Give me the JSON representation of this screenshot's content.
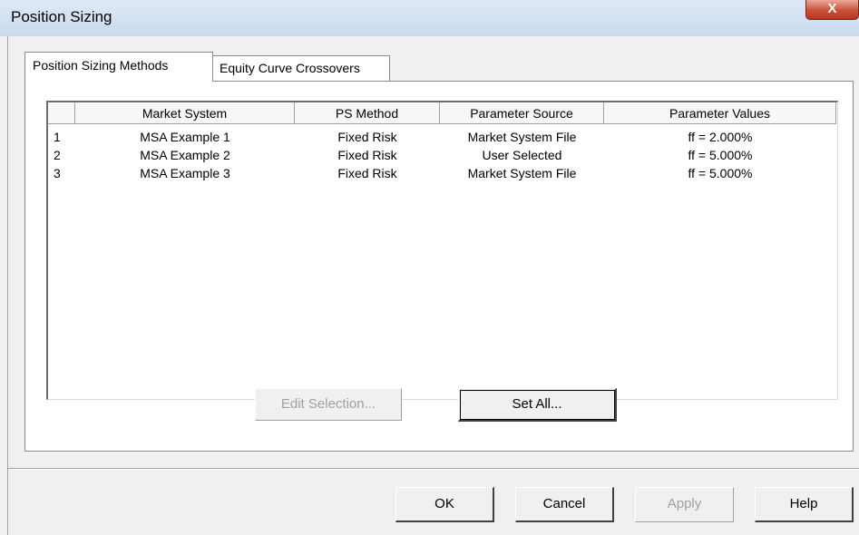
{
  "window": {
    "title": "Position Sizing",
    "close_glyph": "X"
  },
  "tabs": [
    {
      "label": "Position Sizing Methods",
      "active": true
    },
    {
      "label": "Equity Curve Crossovers",
      "active": false
    }
  ],
  "table": {
    "columns": [
      "",
      "Market System",
      "PS Method",
      "Parameter Source",
      "Parameter Values"
    ],
    "rows": [
      {
        "num": "1",
        "market_system": "MSA Example 1",
        "ps_method": "Fixed Risk",
        "parameter_source": "Market System File",
        "parameter_values": "ff = 2.000%"
      },
      {
        "num": "2",
        "market_system": "MSA Example 2",
        "ps_method": "Fixed Risk",
        "parameter_source": "User Selected",
        "parameter_values": "ff = 5.000%"
      },
      {
        "num": "3",
        "market_system": "MSA Example 3",
        "ps_method": "Fixed Risk",
        "parameter_source": "Market System File",
        "parameter_values": "ff = 5.000%"
      }
    ]
  },
  "panel_buttons": {
    "edit_selection": "Edit Selection...",
    "set_all": "Set All..."
  },
  "dialog_buttons": {
    "ok": "OK",
    "cancel": "Cancel",
    "apply": "Apply",
    "help": "Help"
  },
  "colors": {
    "title_bar": "#c9daf0",
    "close_button": "#c9503a",
    "disabled_text": "#a0a0a0"
  }
}
